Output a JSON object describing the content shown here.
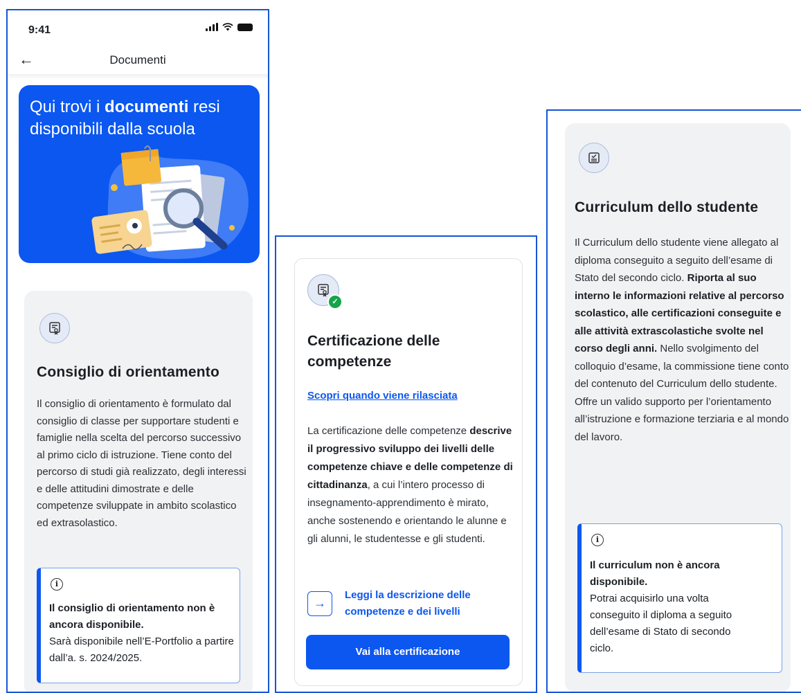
{
  "colors": {
    "accent": "#0b57f0",
    "card_bg": "#f1f2f4",
    "frame_border": "#1555d6"
  },
  "screen1": {
    "status_bar": {
      "time": "9:41",
      "icons": [
        "signal-icon",
        "wifi-icon",
        "battery-icon"
      ]
    },
    "header": {
      "back_icon": "arrow-left-icon",
      "title": "Documenti"
    },
    "hero": {
      "text_before": "Qui trovi i ",
      "text_bold": "documenti",
      "text_after": " resi disponibili dalla scuola",
      "illustration": "documents-magnifier-illustration"
    },
    "card": {
      "icon": "certificate-icon",
      "title": "Consiglio di orientamento",
      "body": "Il consiglio di orientamento è formulato dal consiglio di classe per supportare studenti e famiglie nella scelta del percorso successivo al primo ciclo di istruzione. Tiene conto del percorso di studi già realizzato, degli interessi e delle attitudini dimostrate e delle competenze sviluppate in ambito scolastico ed extrasolastico.",
      "notice": {
        "icon": "info-icon",
        "title": "Il consiglio di orientamento non è ancora disponibile.",
        "text": "Sarà disponibile nell’E-Portfolio a partire dall’a. s. 2024/2025."
      }
    }
  },
  "screen2": {
    "card": {
      "icon": "certificate-check-icon",
      "title": "Certificazione delle competenze",
      "link": "Scopri quando viene rilasciata",
      "body_start": "La certificazione delle competenze ",
      "body_bold": "descrive il progressivo sviluppo dei livelli delle competenze chiave e delle competenze di cittadinanza",
      "body_end": ", a cui l’intero processo di insegnamento-apprendimento è mirato, anche sostenendo e orientando le alunne e gli alunni, le studentesse e gli studenti.",
      "action_icon": "arrow-right-icon",
      "action_link": "Leggi la descrizione delle competenze e dei livelli",
      "button": "Vai alla certificazione"
    }
  },
  "screen3": {
    "card": {
      "icon": "checklist-document-icon",
      "title": "Curriculum dello studente",
      "body_start": "Il Curriculum dello studente viene allegato al diploma conseguito a seguito dell’esame di Stato del secondo ciclo. ",
      "body_bold": "Riporta al suo interno le informazioni relative al percorso scolastico, alle certificazioni conseguite e alle attività extrascolastiche svolte nel corso degli anni.",
      "body_end": " Nello svolgimento del colloquio d’esame, la commissione tiene conto del contenuto del Curriculum dello studente. Offre un valido supporto per l’orientamento all’istruzione e formazione terziaria e al mondo del lavoro.",
      "notice": {
        "icon": "info-icon",
        "title": "Il curriculum non è ancora disponibile.",
        "text": "Potrai acquisirlo una volta conseguito il diploma a seguito dell’esame di Stato di secondo ciclo."
      }
    }
  }
}
